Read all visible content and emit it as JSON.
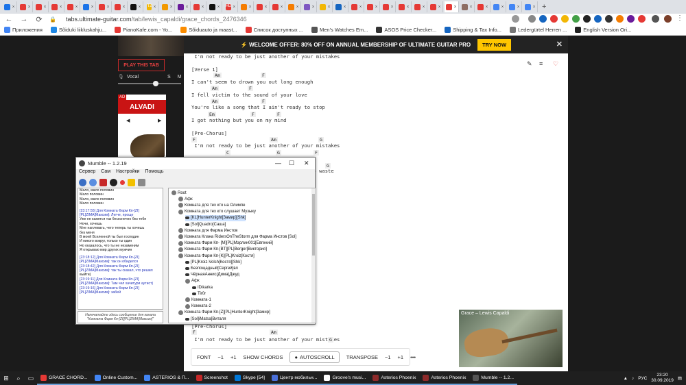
{
  "browser": {
    "tab_icon_colors": [
      "#1a73e8",
      "#e53935",
      "#e53935",
      "#e53935",
      "#e53935",
      "#1a73e8",
      "#e53935",
      "#e53935",
      "#111111",
      "#f2b705",
      "#f29900",
      "#6a1b9a",
      "#e53935",
      "#111111",
      "#e53935",
      "#f57c00",
      "#e53935",
      "#e53935",
      "#f57c00",
      "#7e57c2",
      "#f2b705",
      "#1565c0",
      "#e53935",
      "#e53935",
      "#e53935",
      "#e53935",
      "#e53935",
      "#e53935",
      "#e53935",
      "#8d6e63",
      "#e53935",
      "#4285f4",
      "#4285f4",
      "#4285f4"
    ],
    "tab_labels": {
      "t9": "T2",
      "t14": "HD"
    },
    "active_tab_label": "G",
    "url_host": "tabs.ultimate-guitar.com",
    "url_path": "/tab/lewis_capaldi/grace_chords_2476346",
    "bookmarks": [
      {
        "label": "Приложения",
        "color": "#4285f4"
      },
      {
        "label": "Sõiduki liikluskahju...",
        "color": "#1e88e5"
      },
      {
        "label": "PianoKafe.com - Yo...",
        "color": "#e53935"
      },
      {
        "label": "Sõiduauto ja maast...",
        "color": "#fb8c00"
      },
      {
        "label": "Список доступных ...",
        "color": "#e53935"
      },
      {
        "label": "Men's Watches Em...",
        "color": "#555555"
      },
      {
        "label": "ASOS Price Checker...",
        "color": "#333333"
      },
      {
        "label": "Shipping & Tax Info...",
        "color": "#1565c0"
      },
      {
        "label": "Ledergürtel Herren ...",
        "color": "#777777"
      },
      {
        "label": "English Version Ori...",
        "color": "#222222"
      }
    ]
  },
  "offer": {
    "text": "⚡ WELCOME OFFER: 80% OFF ON ANNUAL MEMBERSHIP OF ULTIMATE GUITAR PRO",
    "button": "TRY NOW",
    "close": "✕"
  },
  "sidebar": {
    "play_tab": "PLAY THIS TAB",
    "vocal_label": "Vocal",
    "vocal_s": "S",
    "vocal_m": "M",
    "ad_badge": "AD",
    "ad_title": "ALVADI",
    "ad_prev": "◀",
    "ad_next": "▶"
  },
  "sheet": {
    "lines": [
      " I'm not ready to be just another of your mistakes",
      "",
      "[Verse 1]",
      "",
      "I can't seem to drown you out long enough",
      "",
      "I fell victim to the sound of your love",
      "",
      "You're like a song that I ain't ready to stop",
      "",
      "I got nothing but you on my mind",
      "",
      "[Pre-Chorus]",
      "",
      " I'm not ready to be just another of your mistakes",
      "",
      "",
      "",
      "                                         o waste"
    ],
    "lower_lines": [
      "[Pre-Chorus]",
      "",
      " I'm not ready to be just another of your mistakes"
    ],
    "chords": {
      "c1": "Am",
      "c2": "F",
      "c3": "Am",
      "c4": "F",
      "c5": "Am",
      "c6": "F",
      "c7": "Em",
      "c8": "F",
      "c9": "F",
      "c10": "F",
      "c11": "Am",
      "c12": "G",
      "c13": "C",
      "c14": "G",
      "c15": "F",
      "c16": "G",
      "c17": "F",
      "c18": "Am",
      "c19": "G"
    }
  },
  "toolbar": {
    "font": "FONT",
    "font_minus": "−1",
    "font_plus": "+1",
    "show_chords": "SHOW CHORDS",
    "autoscroll": "AUTOSCROLL",
    "transpose": "TRANSPOSE",
    "tr_minus": "−1",
    "tr_plus": "+1",
    "more": "•••"
  },
  "video": {
    "title": "Grace – Lewis Capaldi"
  },
  "mumble": {
    "title": "Mumble -- 1.2.19",
    "menu": [
      "Сервер",
      "Сам",
      "Настройки",
      "Помощь"
    ],
    "chat_lines": [
      "Мало, мало половин",
      "Мало половин",
      "Мало, мало половин",
      "Мало половин",
      "",
      "[23:17:55] Для Комната Фарм Кп-[ZI]",
      "[PL]ZIMA[Максим]: Легче, проще",
      "Уже не кажется так бесконечно без тебя",
      "Ночи, хочешь",
      "Мне наплевать, чего теперь ты хочешь",
      "без меня",
      "В моей Вселенной ты был господин",
      "И никого вокруг, только ты один",
      "Но оказалось, что ты не незаменим",
      "Я открываю мир других мужчин",
      "",
      "[23:18:12] Для Комната Фарм Кп-[ZI]",
      "[PL]ZIMA[Максим]: так он обиделся",
      "[23:18:42] Для Комната Фарм Кп-[ZI]",
      "[PL]ZIMA[Максим]: так ты сказал, что решил",
      "выйти)",
      "[23:19:11] Для Комната Фарм Кп-[ZI]",
      "[PL]ZIMA[Максим]: Там чел хачитури аутист)",
      "[23:19:16] Для Комната Фарм Кп-[ZI]",
      "[PL]ZIMA[Максим]: забей"
    ],
    "chat_input": "Напечатайте здесь сообщение для канала \"Комната Фарм Кп-[ZI][PL]ZIMA[Максим]\"",
    "tree": [
      "Root",
      "Афк",
      "Комната для тех кто на Олимпе",
      "Комната для тех кто слушает Музыку",
      "[KL]HunterKnight[Замир][Shk]",
      "[Sol]Quadro[Саша]",
      "Комната для Фарма Инстов",
      "Комната Клана RidersOnTheStorm для Фарма Инстов [Sol]",
      "Комната Фарм Кп- [M][PL]Мэрлин001[Евгений]",
      "Комната Фарм Кп-[BT][PL]Berger[Виктория]",
      "Комната Фарм Кп-[K][PL]Kroiz[Костя]",
      "[PL]Kroiz-Volsh[Костя][Shk]",
      "Безпощадный[Сергей]вл",
      "ЧёрнаяАннис(Дима)Джуд",
      "Афк",
      "IDikarka",
      "Tir0r",
      "Комната-1",
      "Комната-2",
      "Комната Фарм Кп-[Z][PL]HunterKnight[Замир]",
      "[Sol]iMatsa[Виталя"
    ]
  },
  "taskbar": {
    "apps": [
      {
        "label": "GRACE CHORD...",
        "color": "#e53935"
      },
      {
        "label": "Online Custom...",
        "color": "#4285f4"
      },
      {
        "label": "ASTERIOS & П...",
        "color": "#4285f4"
      },
      {
        "label": "Screenshot",
        "color": "#c62828"
      },
      {
        "label": "Skype [54]",
        "color": "#0078d7"
      },
      {
        "label": "Центр мобильн...",
        "color": "#4a6fd8"
      },
      {
        "label": "Groove's musi...",
        "color": "#ffffff"
      },
      {
        "label": "Asterios Phoenix",
        "color": "#8e2b2b"
      },
      {
        "label": "Asterios Phoenix",
        "color": "#8e2b2b"
      },
      {
        "label": "Mumble -- 1.2...",
        "color": "#555555"
      }
    ],
    "lang": "РУС",
    "time": "23:20",
    "date": "30.09.2019"
  }
}
